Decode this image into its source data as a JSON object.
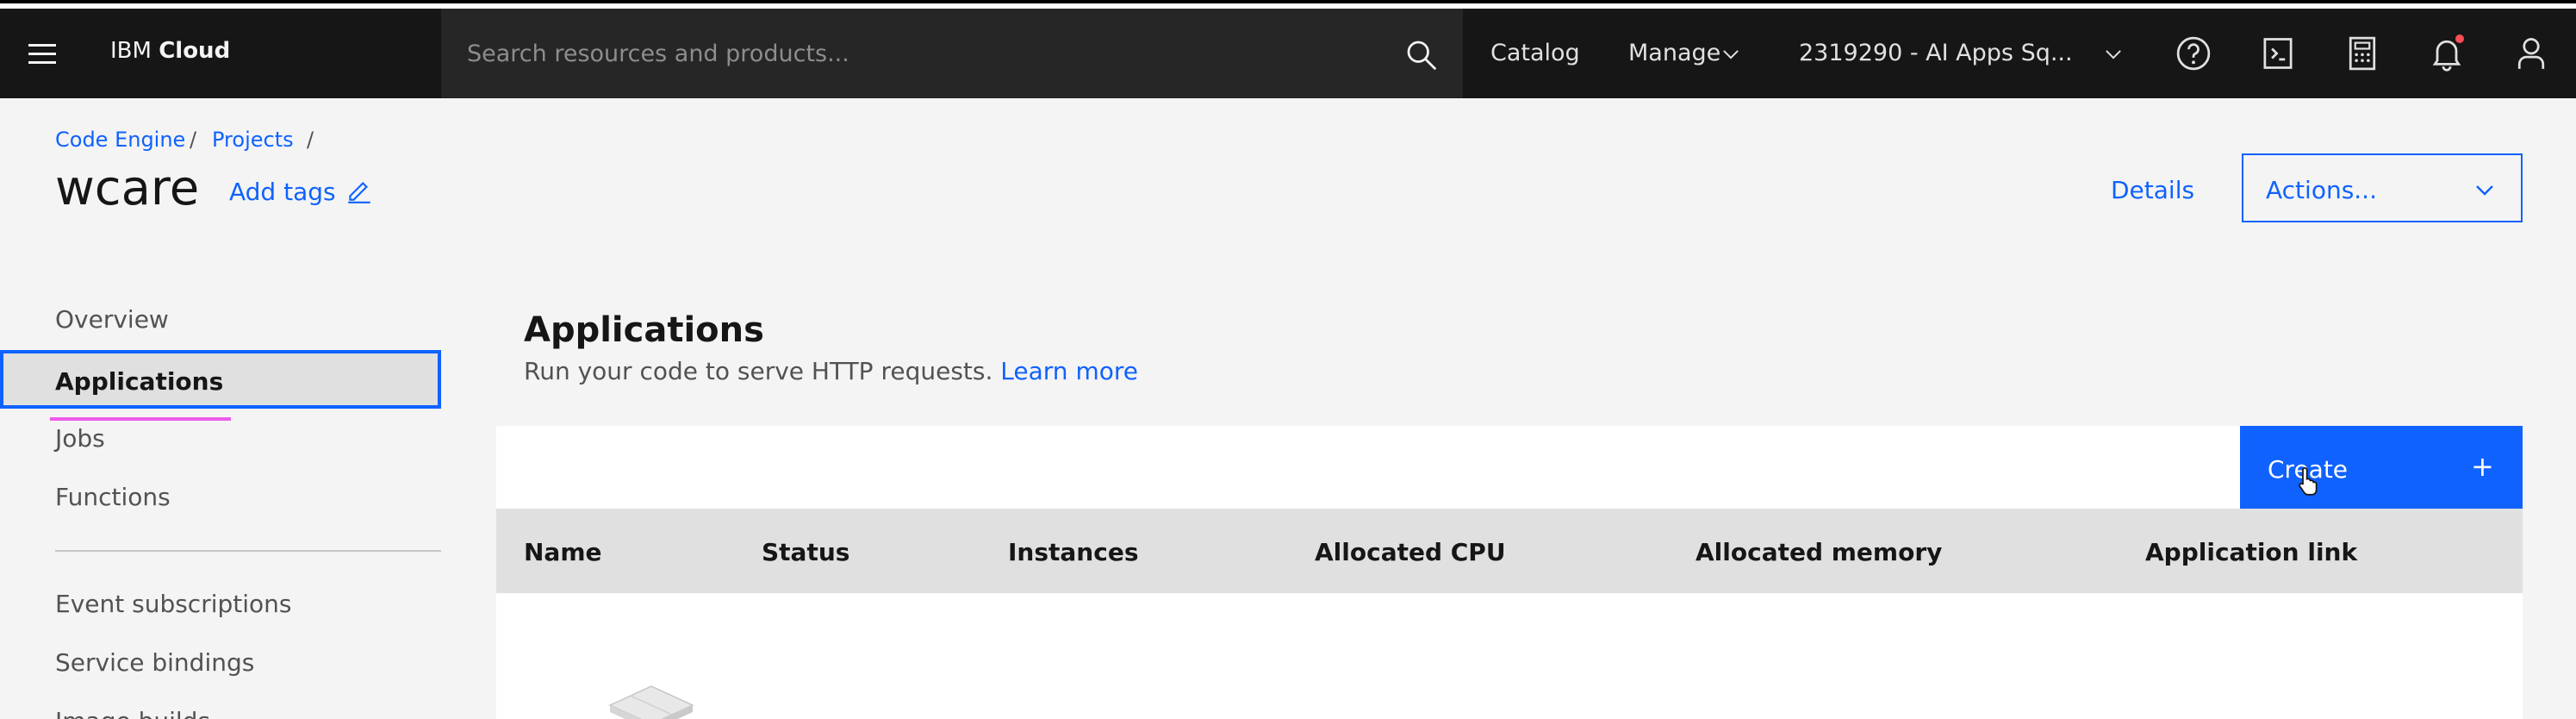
{
  "header": {
    "brand_prefix": "IBM",
    "brand_name": "Cloud",
    "search_placeholder": "Search resources and products...",
    "catalog": "Catalog",
    "manage": "Manage",
    "account": "2319290 - AI Apps Sq..."
  },
  "breadcrumb": {
    "items": [
      "Code Engine",
      "Projects"
    ],
    "separator": "/"
  },
  "page": {
    "title": "wcare",
    "add_tags": "Add tags",
    "details": "Details",
    "actions": "Actions..."
  },
  "sidenav": {
    "items": [
      "Overview",
      "Applications",
      "Jobs",
      "Functions",
      "Event subscriptions",
      "Service bindings",
      "Image builds"
    ],
    "active": "Applications"
  },
  "section": {
    "title": "Applications",
    "description": "Run your code to serve HTTP requests.",
    "learn_more": "Learn more"
  },
  "table": {
    "create_label": "Create",
    "columns": [
      "Name",
      "Status",
      "Instances",
      "Allocated CPU",
      "Allocated memory",
      "Application link"
    ]
  },
  "colors": {
    "header_bg": "#161616",
    "accent": "#0f62fe",
    "annotation": "#ee5beb",
    "notification": "#fa4d56"
  },
  "icons": [
    "menu-icon",
    "search-icon",
    "chevron-down-icon",
    "help-icon",
    "cost-estimator-icon",
    "calculator-icon",
    "notification-icon",
    "user-icon",
    "edit-icon",
    "plus-icon",
    "pointer-cursor-icon"
  ]
}
